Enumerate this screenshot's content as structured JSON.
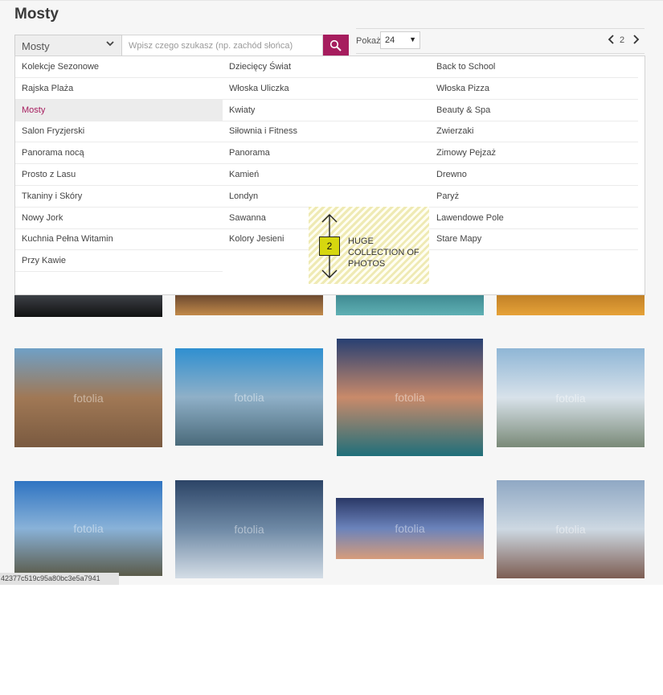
{
  "page": {
    "title": "Mosty"
  },
  "toolbar": {
    "category_select": {
      "selected": "Mosty",
      "icon": "chevron-down-icon"
    },
    "search": {
      "placeholder": "Wpisz czego szukasz (np. zachód słońca)",
      "icon": "search-icon",
      "button_color": "#a61d5e"
    },
    "per_page": {
      "label": "Pokaż",
      "selected": "24"
    },
    "pager": {
      "page": "2"
    }
  },
  "dropdown": {
    "active": "Mosty",
    "accent": "#a61d5e",
    "columns": [
      [
        "Kolekcje Sezonowe",
        "Rajska Plaża",
        "Mosty",
        "Salon Fryzjerski",
        "Panorama nocą",
        "Prosto z Lasu",
        "Tkaniny i Skóry",
        "Nowy Jork",
        "Kuchnia Pełna Witamin",
        "Przy Kawie"
      ],
      [
        "Dziecięcy Świat",
        "Włoska Uliczka",
        "Kwiaty",
        "Siłownia i Fitness",
        "Panorama",
        "Kamień",
        "Londyn",
        "Sawanna",
        "Kolory Jesieni"
      ],
      [
        "Back to School",
        "Włoska Pizza",
        "Beauty & Spa",
        "Zwierzaki",
        "Zimowy Pejzaż",
        "Drewno",
        "Paryż",
        "Lawendowe Pole",
        "Stare Mapy"
      ]
    ]
  },
  "callout": {
    "number": "2",
    "text": "Huge collection of photos",
    "icon": "double-arrow-vertical-icon",
    "badge_color": "#d6d70f"
  },
  "photos": [
    {
      "watermark": "",
      "colors": [
        "#1b1d22",
        "#44484f",
        "#111111"
      ]
    },
    {
      "watermark": "",
      "colors": [
        "#1d2030",
        "#5a3c2a",
        "#c28a4a"
      ]
    },
    {
      "watermark": "",
      "colors": [
        "#1f3a44",
        "#39828a",
        "#5fb0b4"
      ]
    },
    {
      "watermark": "",
      "colors": [
        "#4a3a20",
        "#b97a24",
        "#e6a238"
      ]
    },
    {
      "watermark": "fotolia",
      "colors": [
        "#6fa0c6",
        "#a07855",
        "#7a5a40"
      ]
    },
    {
      "watermark": "fotolia",
      "colors": [
        "#2f8fd0",
        "#8fb0c8",
        "#4a6a7a"
      ]
    },
    {
      "watermark": "fotolia",
      "colors": [
        "#273f72",
        "#c98a6a",
        "#1f6f7a"
      ]
    },
    {
      "watermark": "fotolia",
      "colors": [
        "#8fb6d6",
        "#d8e2ea",
        "#7a8a78"
      ]
    },
    {
      "watermark": "fotolia",
      "colors": [
        "#2f74c2",
        "#89b2d8",
        "#5b5b4a"
      ]
    },
    {
      "watermark": "fotolia",
      "colors": [
        "#2c4466",
        "#6f8aa6",
        "#d4dde6"
      ]
    },
    {
      "watermark": "fotolia",
      "colors": [
        "#2a3866",
        "#6b83bb",
        "#d79c7a"
      ]
    },
    {
      "watermark": "fotolia",
      "colors": [
        "#8fa8c4",
        "#cdd8e2",
        "#7d5d52"
      ]
    }
  ],
  "footer": {
    "hash": "42377c519c95a80bc3e5a7941"
  }
}
